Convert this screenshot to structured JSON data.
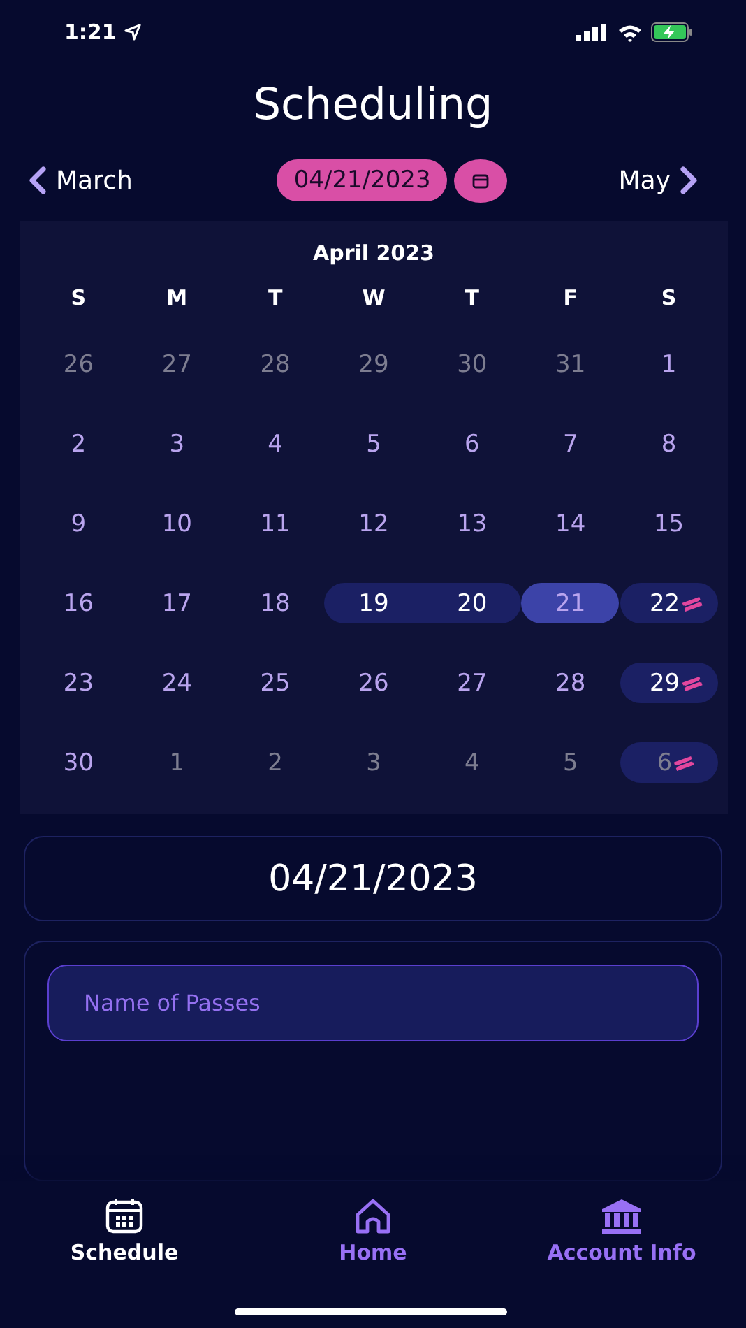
{
  "status_bar": {
    "time": "1:21"
  },
  "title": "Scheduling",
  "month_nav": {
    "previous": "March",
    "date": "04/21/2023",
    "next": "May"
  },
  "calendar": {
    "month": "April 2023",
    "weekdays": [
      "S",
      "M",
      "T",
      "W",
      "T",
      "F",
      "S"
    ],
    "days": [
      {
        "label": "26",
        "outside": true,
        "kind": "plain"
      },
      {
        "label": "27",
        "outside": true,
        "kind": "plain"
      },
      {
        "label": "28",
        "outside": true,
        "kind": "plain"
      },
      {
        "label": "29",
        "outside": true,
        "kind": "plain"
      },
      {
        "label": "30",
        "outside": true,
        "kind": "plain"
      },
      {
        "label": "31",
        "outside": true,
        "kind": "plain"
      },
      {
        "label": "1",
        "outside": false,
        "kind": "plain"
      },
      {
        "label": "2",
        "outside": false,
        "kind": "plain"
      },
      {
        "label": "3",
        "outside": false,
        "kind": "plain"
      },
      {
        "label": "4",
        "outside": false,
        "kind": "plain"
      },
      {
        "label": "5",
        "outside": false,
        "kind": "plain"
      },
      {
        "label": "6",
        "outside": false,
        "kind": "plain"
      },
      {
        "label": "7",
        "outside": false,
        "kind": "plain"
      },
      {
        "label": "8",
        "outside": false,
        "kind": "plain"
      },
      {
        "label": "9",
        "outside": false,
        "kind": "plain"
      },
      {
        "label": "10",
        "outside": false,
        "kind": "plain"
      },
      {
        "label": "11",
        "outside": false,
        "kind": "plain"
      },
      {
        "label": "12",
        "outside": false,
        "kind": "plain"
      },
      {
        "label": "13",
        "outside": false,
        "kind": "plain"
      },
      {
        "label": "14",
        "outside": false,
        "kind": "plain"
      },
      {
        "label": "15",
        "outside": false,
        "kind": "plain"
      },
      {
        "label": "16",
        "outside": false,
        "kind": "plain"
      },
      {
        "label": "17",
        "outside": false,
        "kind": "plain"
      },
      {
        "label": "18",
        "outside": false,
        "kind": "plain"
      },
      {
        "label": "19",
        "outside": false,
        "kind": "range_start"
      },
      {
        "label": "20",
        "outside": false,
        "kind": "range_end"
      },
      {
        "label": "21",
        "outside": false,
        "kind": "selected"
      },
      {
        "label": "22",
        "outside": false,
        "kind": "event"
      },
      {
        "label": "23",
        "outside": false,
        "kind": "plain"
      },
      {
        "label": "24",
        "outside": false,
        "kind": "plain"
      },
      {
        "label": "25",
        "outside": false,
        "kind": "plain"
      },
      {
        "label": "26",
        "outside": false,
        "kind": "plain"
      },
      {
        "label": "27",
        "outside": false,
        "kind": "plain"
      },
      {
        "label": "28",
        "outside": false,
        "kind": "plain"
      },
      {
        "label": "29",
        "outside": false,
        "kind": "event"
      },
      {
        "label": "30",
        "outside": false,
        "kind": "plain"
      },
      {
        "label": "1",
        "outside": true,
        "kind": "plain"
      },
      {
        "label": "2",
        "outside": true,
        "kind": "plain"
      },
      {
        "label": "3",
        "outside": true,
        "kind": "plain"
      },
      {
        "label": "4",
        "outside": true,
        "kind": "plain"
      },
      {
        "label": "5",
        "outside": true,
        "kind": "plain"
      },
      {
        "label": "6",
        "outside": true,
        "kind": "event"
      }
    ]
  },
  "selected_date": "04/21/2023",
  "form": {
    "passes_field": {
      "placeholder": "Name of Passes"
    }
  },
  "tab_bar": [
    {
      "label": "Schedule",
      "selected": true
    },
    {
      "label": "Home",
      "selected": false
    },
    {
      "label": "Account Info",
      "selected": false
    }
  ]
}
